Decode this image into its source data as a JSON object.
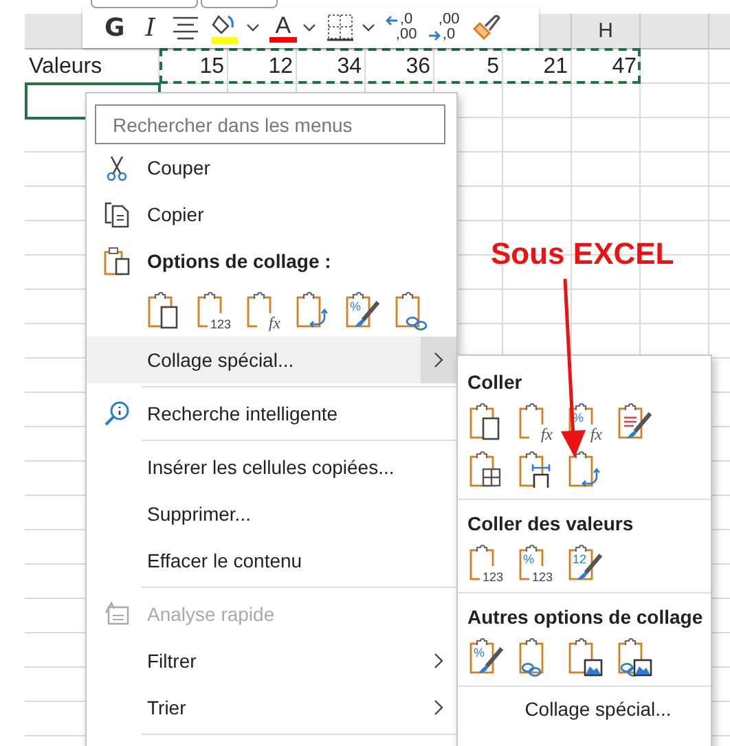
{
  "sheet": {
    "column_headers": [
      {
        "label": "H"
      }
    ],
    "label_cell": "Valeurs",
    "values": [
      "15",
      "12",
      "34",
      "36",
      "5",
      "21",
      "47"
    ],
    "values_copied": true,
    "active_cell_below": true
  },
  "toolbar": {
    "buttons": [
      {
        "kind": "bold",
        "label": "G",
        "dropdown": false
      },
      {
        "kind": "italic",
        "label": "I",
        "dropdown": false
      },
      {
        "kind": "align",
        "dropdown": false
      },
      {
        "kind": "fill",
        "color": "#ffff00",
        "dropdown": true
      },
      {
        "kind": "font_color",
        "label": "A",
        "color": "#ff0000",
        "dropdown": true
      },
      {
        "kind": "borders",
        "dropdown": true
      },
      {
        "kind": "decimal_less",
        "top": ",0",
        "bottom": ",00",
        "dropdown": false
      },
      {
        "kind": "decimal_more",
        "top": ",00",
        "bottom": ",0",
        "dropdown": false
      },
      {
        "kind": "painter",
        "dropdown": false
      }
    ]
  },
  "context_menu": {
    "search": {
      "placeholder": "Rechercher dans les menus"
    },
    "items": [
      {
        "kind": "item",
        "label": "Couper",
        "highlighted": false,
        "disabled": false,
        "submenu": false,
        "separator_after": false
      },
      {
        "kind": "item",
        "label": "Copier",
        "highlighted": false,
        "disabled": false,
        "submenu": false,
        "separator_after": false
      },
      {
        "kind": "heading",
        "label": "Options de collage :",
        "separator_after": false
      },
      {
        "kind": "paste_row",
        "options": [
          {
            "kind": "keep"
          },
          {
            "kind": "plain",
            "badge": "123"
          },
          {
            "kind": "plain",
            "badge": "fx"
          },
          {
            "kind": "transpose"
          },
          {
            "kind": "brush",
            "top_badge": "%"
          },
          {
            "kind": "link"
          }
        ],
        "separator_after": false
      },
      {
        "kind": "item",
        "label": "Collage spécial...",
        "highlighted": true,
        "disabled": false,
        "submenu": true,
        "separator_after": true
      },
      {
        "kind": "item",
        "label": "Recherche intelligente",
        "highlighted": false,
        "disabled": false,
        "submenu": false,
        "separator_after": true
      },
      {
        "kind": "item",
        "label": "Insérer les cellules copiées...",
        "highlighted": false,
        "disabled": false,
        "submenu": false,
        "separator_after": false
      },
      {
        "kind": "item",
        "label": "Supprimer...",
        "highlighted": false,
        "disabled": false,
        "submenu": false,
        "separator_after": false
      },
      {
        "kind": "item",
        "label": "Effacer le contenu",
        "highlighted": false,
        "disabled": false,
        "submenu": false,
        "separator_after": true
      },
      {
        "kind": "item",
        "label": "Analyse rapide",
        "highlighted": false,
        "disabled": true,
        "submenu": false,
        "separator_after": false
      },
      {
        "kind": "item",
        "label": "Filtrer",
        "highlighted": false,
        "disabled": false,
        "submenu": true,
        "separator_after": false
      },
      {
        "kind": "item",
        "label": "Trier",
        "highlighted": false,
        "disabled": false,
        "submenu": true,
        "separator_after": true
      }
    ]
  },
  "submenu": {
    "sections": [
      {
        "title": "Coller",
        "rows": [
          [
            {
              "kind": "keep"
            },
            {
              "kind": "plain",
              "badge": "fx"
            },
            {
              "kind": "plain",
              "badge": "fx",
              "top_badge": "%"
            },
            {
              "kind": "brush_lines"
            }
          ],
          [
            {
              "kind": "borders"
            },
            {
              "kind": "width"
            },
            {
              "kind": "transpose"
            }
          ]
        ]
      },
      {
        "title": "Coller des valeurs",
        "rows": [
          [
            {
              "kind": "plain",
              "badge": "123"
            },
            {
              "kind": "plain",
              "badge": "123",
              "top_badge": "%"
            },
            {
              "kind": "brush",
              "top_badge": "12"
            }
          ]
        ]
      },
      {
        "title": "Autres options de collage",
        "rows": [
          [
            {
              "kind": "brush",
              "top_badge": "%"
            },
            {
              "kind": "link"
            },
            {
              "kind": "picture"
            },
            {
              "kind": "linked_picture"
            }
          ]
        ]
      }
    ],
    "footer": "Collage spécial..."
  },
  "annotation": {
    "text": "Sous EXCEL"
  }
}
